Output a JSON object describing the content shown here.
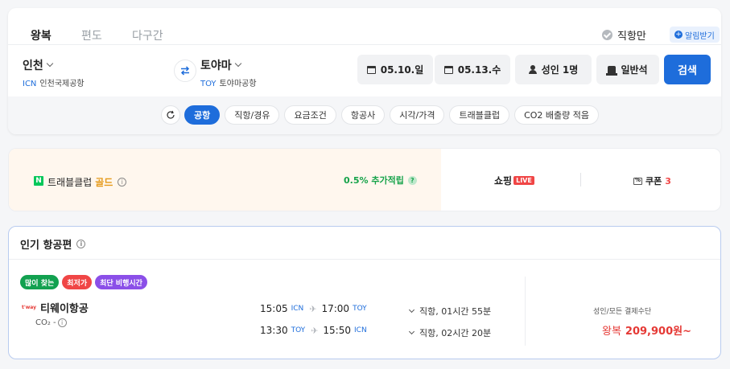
{
  "trip_tabs": [
    {
      "label": "왕복",
      "active": true
    },
    {
      "label": "편도",
      "active": false
    },
    {
      "label": "다구간",
      "active": false
    }
  ],
  "direct_only_label": "직항만",
  "alert_label": "알림받기",
  "origin": {
    "city": "인천",
    "code": "ICN",
    "airport": "인천국제공항"
  },
  "destination": {
    "city": "토야마",
    "code": "TOY",
    "airport": "토야마공항"
  },
  "depart_date": "05.10.일",
  "return_date": "05.13.수",
  "passengers": "성인 1명",
  "seat_class": "일반석",
  "search_label": "검색",
  "filters": [
    {
      "label": "공항",
      "active": true
    },
    {
      "label": "직항/경유",
      "active": false
    },
    {
      "label": "요금조건",
      "active": false
    },
    {
      "label": "항공사",
      "active": false
    },
    {
      "label": "시각/가격",
      "active": false
    },
    {
      "label": "트래블클럽",
      "active": false
    },
    {
      "label": "CO2 배출량 적음",
      "active": false
    }
  ],
  "membership": {
    "logo_letter": "N",
    "club": "트래블클럽",
    "tier": "골드",
    "info": "i",
    "accrual": "0.5% 추가적립",
    "accrual_help": "?",
    "shopping": "쇼핑",
    "live": "LIVE",
    "coupon_label": "쿠폰",
    "coupon_icon_text": "%",
    "coupon_count": "3"
  },
  "popular": {
    "title": "인기 항공편",
    "info": "i",
    "badges": [
      {
        "label": "많이 찾는",
        "color": "#12a150"
      },
      {
        "label": "최저가",
        "color": "#f04646"
      },
      {
        "label": "최단 비행시간",
        "color": "#8b4fe8"
      }
    ],
    "airline_logo": "t'way",
    "airline": "티웨이항공",
    "co2_label": "CO₂ -",
    "co2_info": "i",
    "legs": [
      {
        "dep_time": "15:05",
        "dep_code": "ICN",
        "arr_time": "17:00",
        "arr_code": "TOY",
        "info": "직항, 01시간 55분"
      },
      {
        "dep_time": "13:30",
        "dep_code": "TOY",
        "arr_time": "15:50",
        "arr_code": "ICN",
        "info": "직항, 02시간 20분"
      }
    ],
    "payment_note": "성인/모든 결제수단",
    "price_prefix": "왕복",
    "price": "209,900원~"
  }
}
